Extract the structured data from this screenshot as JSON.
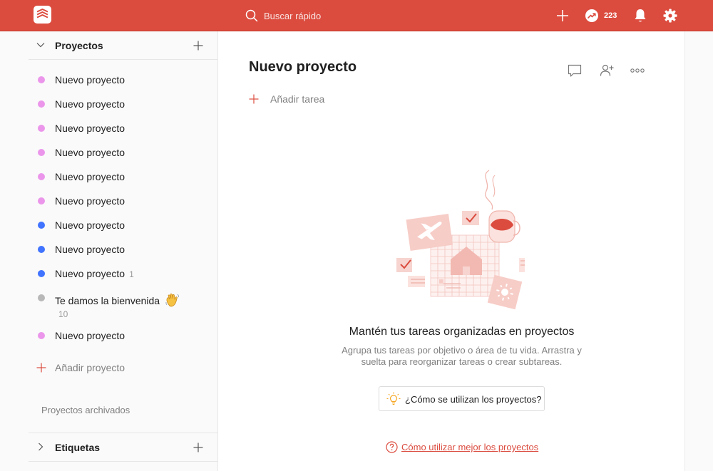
{
  "topbar": {
    "search_placeholder": "Buscar rápido",
    "karma_count": "223"
  },
  "sidebar": {
    "projects_title": "Proyectos",
    "projects": [
      {
        "name": "Nuevo proyecto",
        "color": "#eb96eb",
        "count": ""
      },
      {
        "name": "Nuevo proyecto",
        "color": "#eb96eb",
        "count": ""
      },
      {
        "name": "Nuevo proyecto",
        "color": "#eb96eb",
        "count": ""
      },
      {
        "name": "Nuevo proyecto",
        "color": "#eb96eb",
        "count": ""
      },
      {
        "name": "Nuevo proyecto",
        "color": "#eb96eb",
        "count": ""
      },
      {
        "name": "Nuevo proyecto",
        "color": "#eb96eb",
        "count": ""
      },
      {
        "name": "Nuevo proyecto",
        "color": "#4073ff",
        "count": ""
      },
      {
        "name": "Nuevo proyecto",
        "color": "#4073ff",
        "count": ""
      },
      {
        "name": "Nuevo proyecto",
        "color": "#4073ff",
        "count": "1"
      },
      {
        "name": "Te damos la bienvenida",
        "color": "#b8b8b8",
        "count": "10"
      },
      {
        "name": "Nuevo proyecto",
        "color": "#eb96eb",
        "count": ""
      }
    ],
    "add_project_label": "Añadir proyecto",
    "archived_label": "Proyectos archivados",
    "labels_title": "Etiquetas"
  },
  "main": {
    "title": "Nuevo proyecto",
    "add_task_label": "Añadir tarea",
    "empty_title": "Mantén tus tareas organizadas en proyectos",
    "empty_desc": "Agrupa tus tareas por objetivo o área de tu vida. Arrastra y suelta para reorganizar tareas o crear subtareas.",
    "help_button_label": "¿Cómo se utilizan los proyectos?",
    "help_link_label": "Cómo utilizar mejor los proyectos"
  },
  "colors": {
    "brand": "#db4c3f",
    "pink": "#eb96eb",
    "blue": "#4073ff",
    "grey": "#b8b8b8"
  }
}
